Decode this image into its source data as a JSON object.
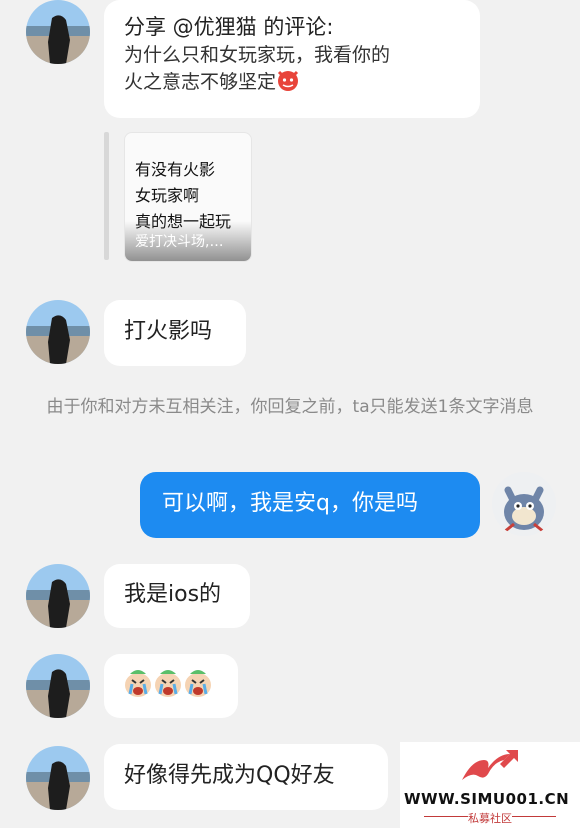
{
  "messages": {
    "share": {
      "title": "分享 @优狸猫 的评论:",
      "line1": "为什么只和女玩家玩，我看你的",
      "line2": "火之意志不够坚定",
      "emoji": "devil-emoji"
    },
    "shared_post": {
      "line1": "有没有火影",
      "line2": "女玩家啊",
      "line3": "真的想一起玩",
      "caption": "爱打决斗场,…"
    },
    "msg_play_naruto": "打火影吗",
    "system_note": "由于你和对方未互相关注，你回复之前，ta只能发送1条文字消息",
    "msg_mine": "可以啊，我是安q，你是吗",
    "msg_ios": "我是ios的",
    "msg_crying": "crying-emoji-x3",
    "msg_qq": "好像得先成为QQ好友"
  },
  "watermark": {
    "url": "WWW.SIMU001.CN",
    "subtitle": "私募社区"
  },
  "colors": {
    "background": "#f1f1f1",
    "bubble": "#ffffff",
    "my_bubble": "#1d8bf1",
    "system_text": "#8a8a8a"
  }
}
